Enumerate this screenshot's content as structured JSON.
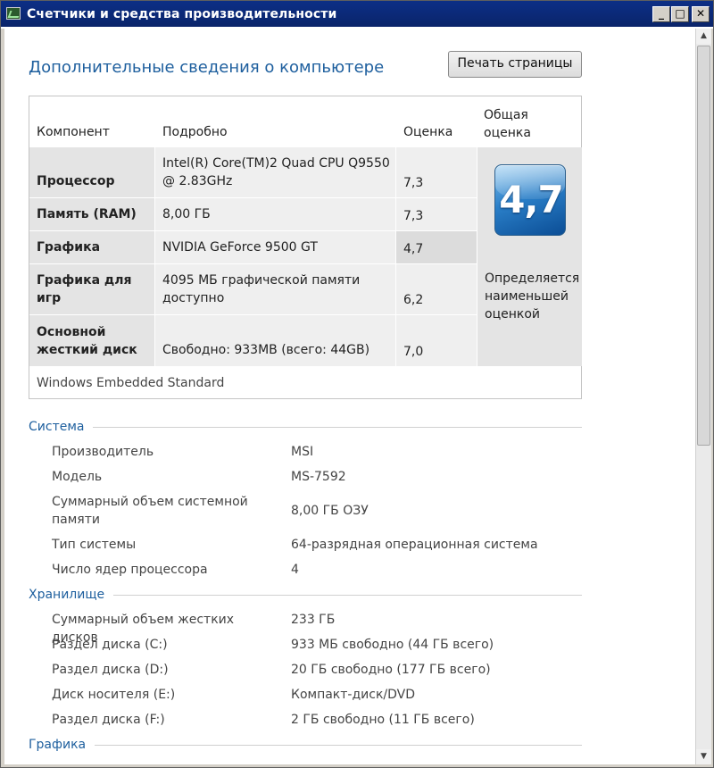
{
  "window": {
    "title": "Счетчики и средства производительности",
    "buttons": {
      "minimize": "_",
      "maximize": "□",
      "close": "✕"
    }
  },
  "page": {
    "title": "Дополнительные сведения о компьютере",
    "print_button": "Печать страницы"
  },
  "scores": {
    "headers": {
      "component": "Компонент",
      "detail": "Подробно",
      "score": "Оценка",
      "overall_line1": "Общая",
      "overall_line2": "оценка"
    },
    "rows": [
      {
        "component": "Процессор",
        "detail": "Intel(R) Core(TM)2 Quad CPU Q9550 @ 2.83GHz",
        "score": "7,3"
      },
      {
        "component": "Память (RAM)",
        "detail": "8,00 ГБ",
        "score": "7,3"
      },
      {
        "component": "Графика",
        "detail": "NVIDIA GeForce 9500 GT",
        "score": "4,7"
      },
      {
        "component": "Графика для игр",
        "detail": "4095 МБ графической памяти доступно",
        "score": "6,2"
      },
      {
        "component": "Основной жесткий диск",
        "detail": "Свободно: 933MB (всего: 44GB)",
        "score": "7,0"
      }
    ],
    "overall": "4,7",
    "overall_note": "Определяется наименьшей оценкой",
    "os_name": "Windows Embedded Standard"
  },
  "sections": {
    "system": {
      "title": "Система",
      "items": [
        {
          "label": "Производитель",
          "value": "MSI"
        },
        {
          "label": "Модель",
          "value": "MS-7592"
        },
        {
          "label": "Суммарный объем системной памяти",
          "value": "8,00 ГБ ОЗУ"
        },
        {
          "label": "Тип системы",
          "value": "64-разрядная операционная система"
        },
        {
          "label": "Число ядер процессора",
          "value": "4"
        }
      ]
    },
    "storage": {
      "title": "Хранилище",
      "items": [
        {
          "label": "Суммарный объем жестких дисков",
          "value": "233 ГБ"
        },
        {
          "label": "Раздел диска (C:)",
          "value": "933 МБ свободно (44 ГБ всего)"
        },
        {
          "label": "Раздел диска (D:)",
          "value": "20 ГБ свободно (177 ГБ всего)"
        },
        {
          "label": "Диск носителя (E:)",
          "value": "Компакт-диск/DVD"
        },
        {
          "label": "Раздел диска (F:)",
          "value": "2 ГБ свободно (11 ГБ всего)"
        }
      ]
    },
    "graphics": {
      "title": "Графика"
    }
  },
  "colors": {
    "accent": "#1e5f9e",
    "titlebar": "#0a246a"
  }
}
